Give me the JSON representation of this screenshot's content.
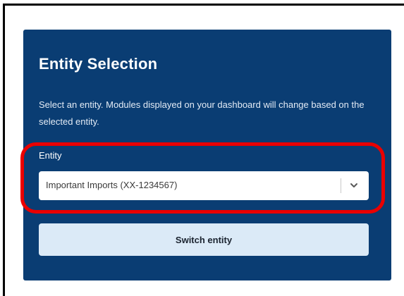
{
  "panel": {
    "title": "Entity Selection",
    "description": "Select an entity.  Modules displayed on your dashboard will change based on the selected entity."
  },
  "entity_select": {
    "label": "Entity",
    "selected_value": "Important Imports (XX-1234567)",
    "icon": "chevron-down-icon"
  },
  "actions": {
    "switch_label": "Switch entity"
  },
  "colors": {
    "panel_background": "#0a3d73",
    "button_background": "#dbeaf7",
    "highlight_outline": "#ea0000"
  }
}
